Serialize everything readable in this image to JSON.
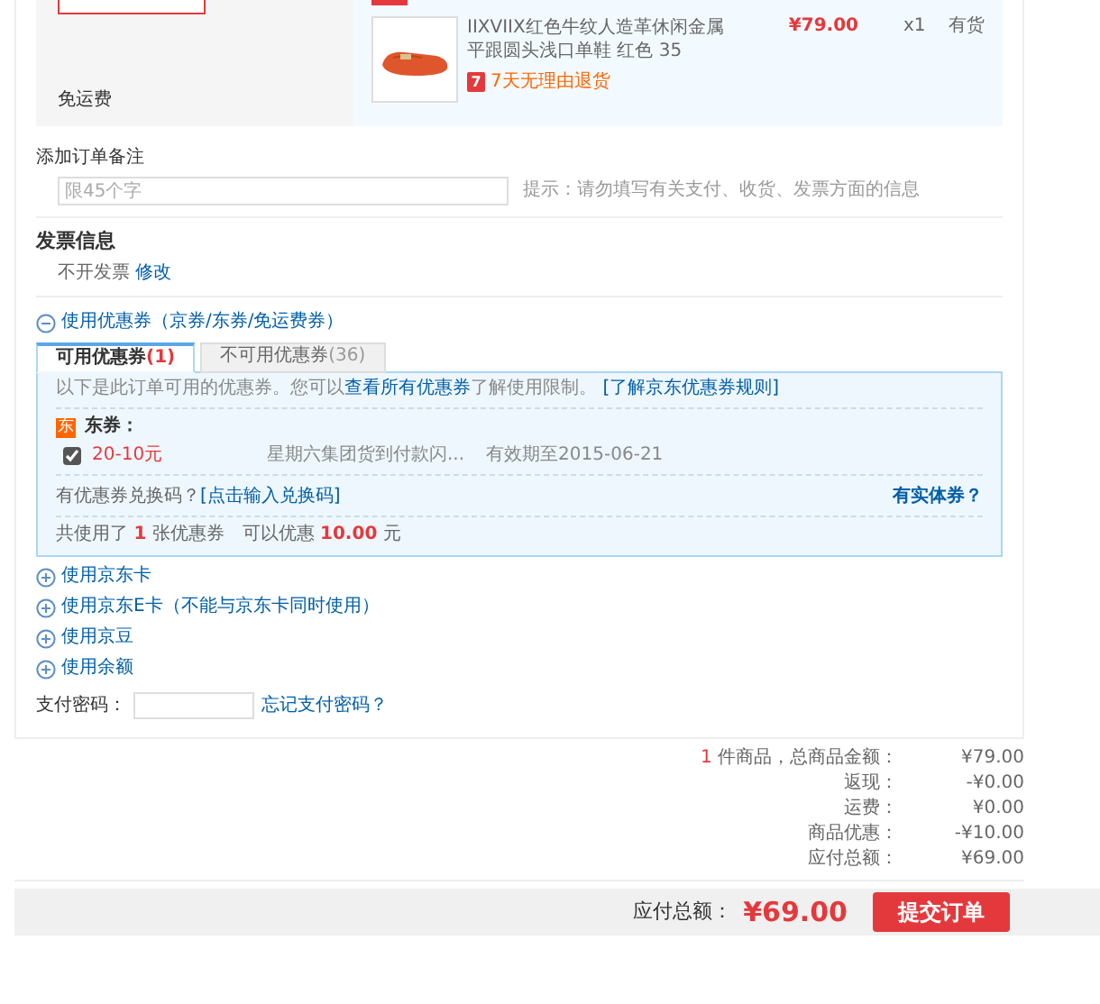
{
  "shipping_panel": {
    "label": "免运费"
  },
  "product": {
    "name": "IIXVIIX红色牛纹人造革休闲金属平跟圆头浅口单鞋 红色 35",
    "return_badge": "7",
    "return_policy": "7天无理由退货",
    "price": "¥79.00",
    "quantity": "x1",
    "stock": "有货"
  },
  "order_note": {
    "label": "添加订单备注",
    "placeholder": "限45个字",
    "hint": "提示：请勿填写有关支付、收货、发票方面的信息"
  },
  "invoice": {
    "title": "发票信息",
    "value": "不开发票",
    "edit_link": "修改"
  },
  "coupons": {
    "expanded": true,
    "title": "使用优惠券（京券/东券/免运费券）",
    "tabs": [
      {
        "label": "可用优惠券",
        "count": "(1)",
        "selected": true
      },
      {
        "label": "不可用优惠券",
        "count": "(36)",
        "selected": false
      }
    ],
    "intro_before": "以下是此订单可用的优惠券。您可以",
    "view_all_link": "查看所有优惠券",
    "intro_after": "了解使用限制。",
    "rules_link": "[了解京东优惠券规则]",
    "group": {
      "badge": "东",
      "title": "东券：",
      "items": [
        {
          "checked": true,
          "amount": "20-10元",
          "description": "星期六集团货到付款闪...",
          "expiry": "有效期至2015-06-21"
        }
      ]
    },
    "redeem_question": "有优惠券兑换码？",
    "redeem_link": "[点击输入兑换码]",
    "physical_link": "有实体券？",
    "total_text": "共使用了 **1** 张优惠券　可以优惠 **10.00** 元"
  },
  "options": [
    {
      "label": "使用京东卡",
      "expanded": false
    },
    {
      "label": "使用京东E卡（不能与京东卡同时使用）",
      "expanded": false
    },
    {
      "label": "使用京豆",
      "expanded": false
    },
    {
      "label": "使用余额",
      "expanded": false
    }
  ],
  "payment_password": {
    "label": "支付密码：",
    "forgot_link": "忘记支付密码？"
  },
  "summary": [
    {
      "count": "1",
      "label": "件商品，总商品金额：",
      "value": "¥79.00"
    },
    {
      "label": "返现：",
      "value": "-¥0.00"
    },
    {
      "label": "运费：",
      "value": "¥0.00"
    },
    {
      "label": "商品优惠：",
      "value": "-¥10.00"
    },
    {
      "label": "应付总额：",
      "value": "¥69.00"
    }
  ],
  "footer": {
    "total_label": "应付总额：",
    "total": "¥69.00",
    "submit": "提交订单"
  }
}
